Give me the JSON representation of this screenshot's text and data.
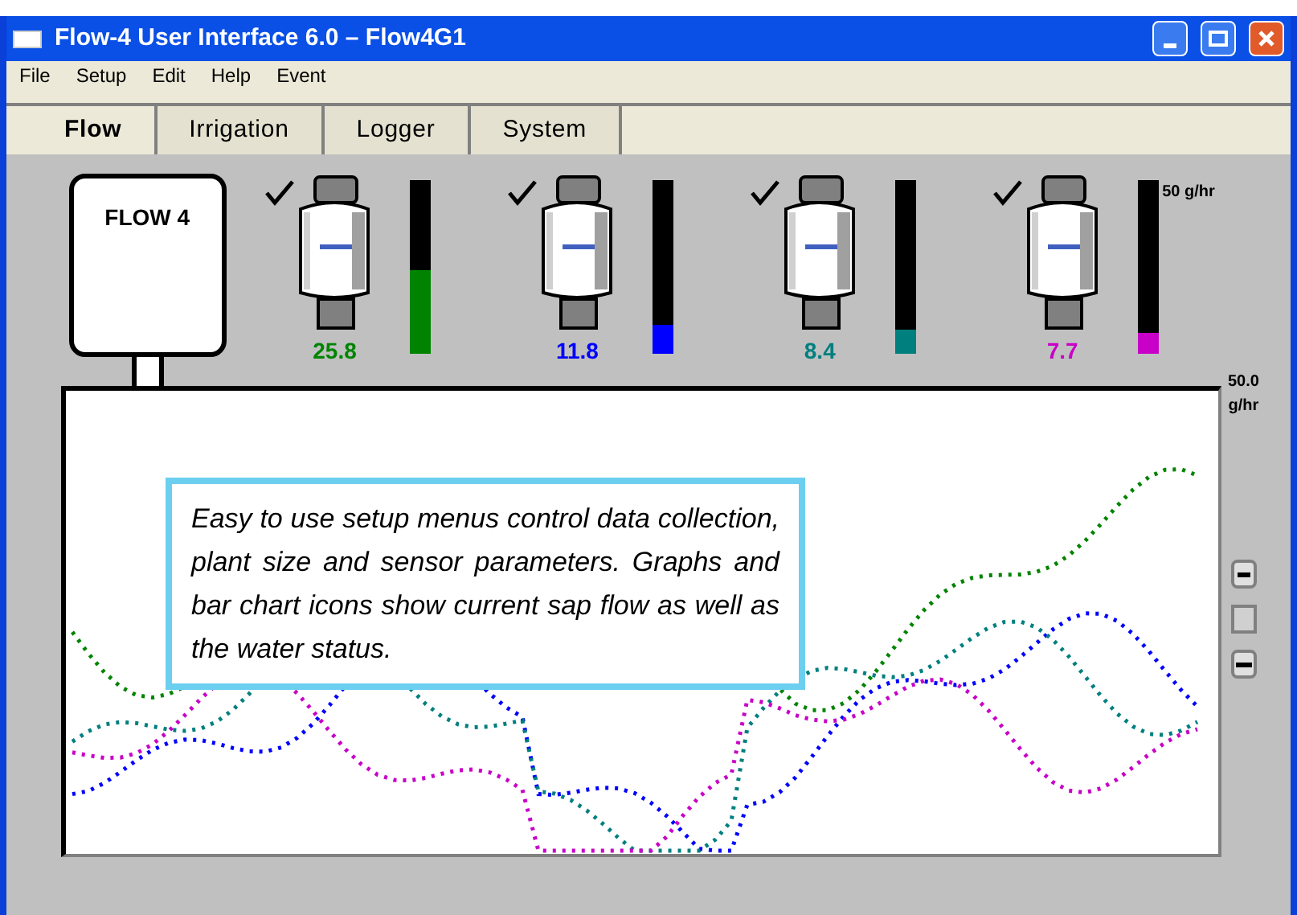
{
  "window": {
    "title": "Flow-4 User Interface 6.0 – Flow4G1"
  },
  "menu": [
    "File",
    "Setup",
    "Edit",
    "Help",
    "Event"
  ],
  "tabs": [
    {
      "label": "Flow",
      "selected": true
    },
    {
      "label": "Irrigation",
      "selected": false
    },
    {
      "label": "Logger",
      "selected": false
    },
    {
      "label": "System",
      "selected": false
    }
  ],
  "logger": {
    "label": "FLOW 4"
  },
  "sensors": [
    {
      "checked": true,
      "reading": "25.8",
      "level": 0.48,
      "color": "#008400"
    },
    {
      "checked": true,
      "reading": "11.8",
      "level": 0.17,
      "color": "#0000ff"
    },
    {
      "checked": true,
      "reading": "8.4",
      "level": 0.14,
      "color": "#007f7f"
    },
    {
      "checked": true,
      "reading": "7.7",
      "level": 0.12,
      "color": "#c800c8"
    }
  ],
  "scale": {
    "top": "50 g/hr",
    "bottom_value": "50.0",
    "bottom_unit": "g/hr"
  },
  "callout": "Easy to use setup menus control data collection, plant size and sensor parameters.  Graphs and bar chart icons show current sap flow as well as the water status."
}
